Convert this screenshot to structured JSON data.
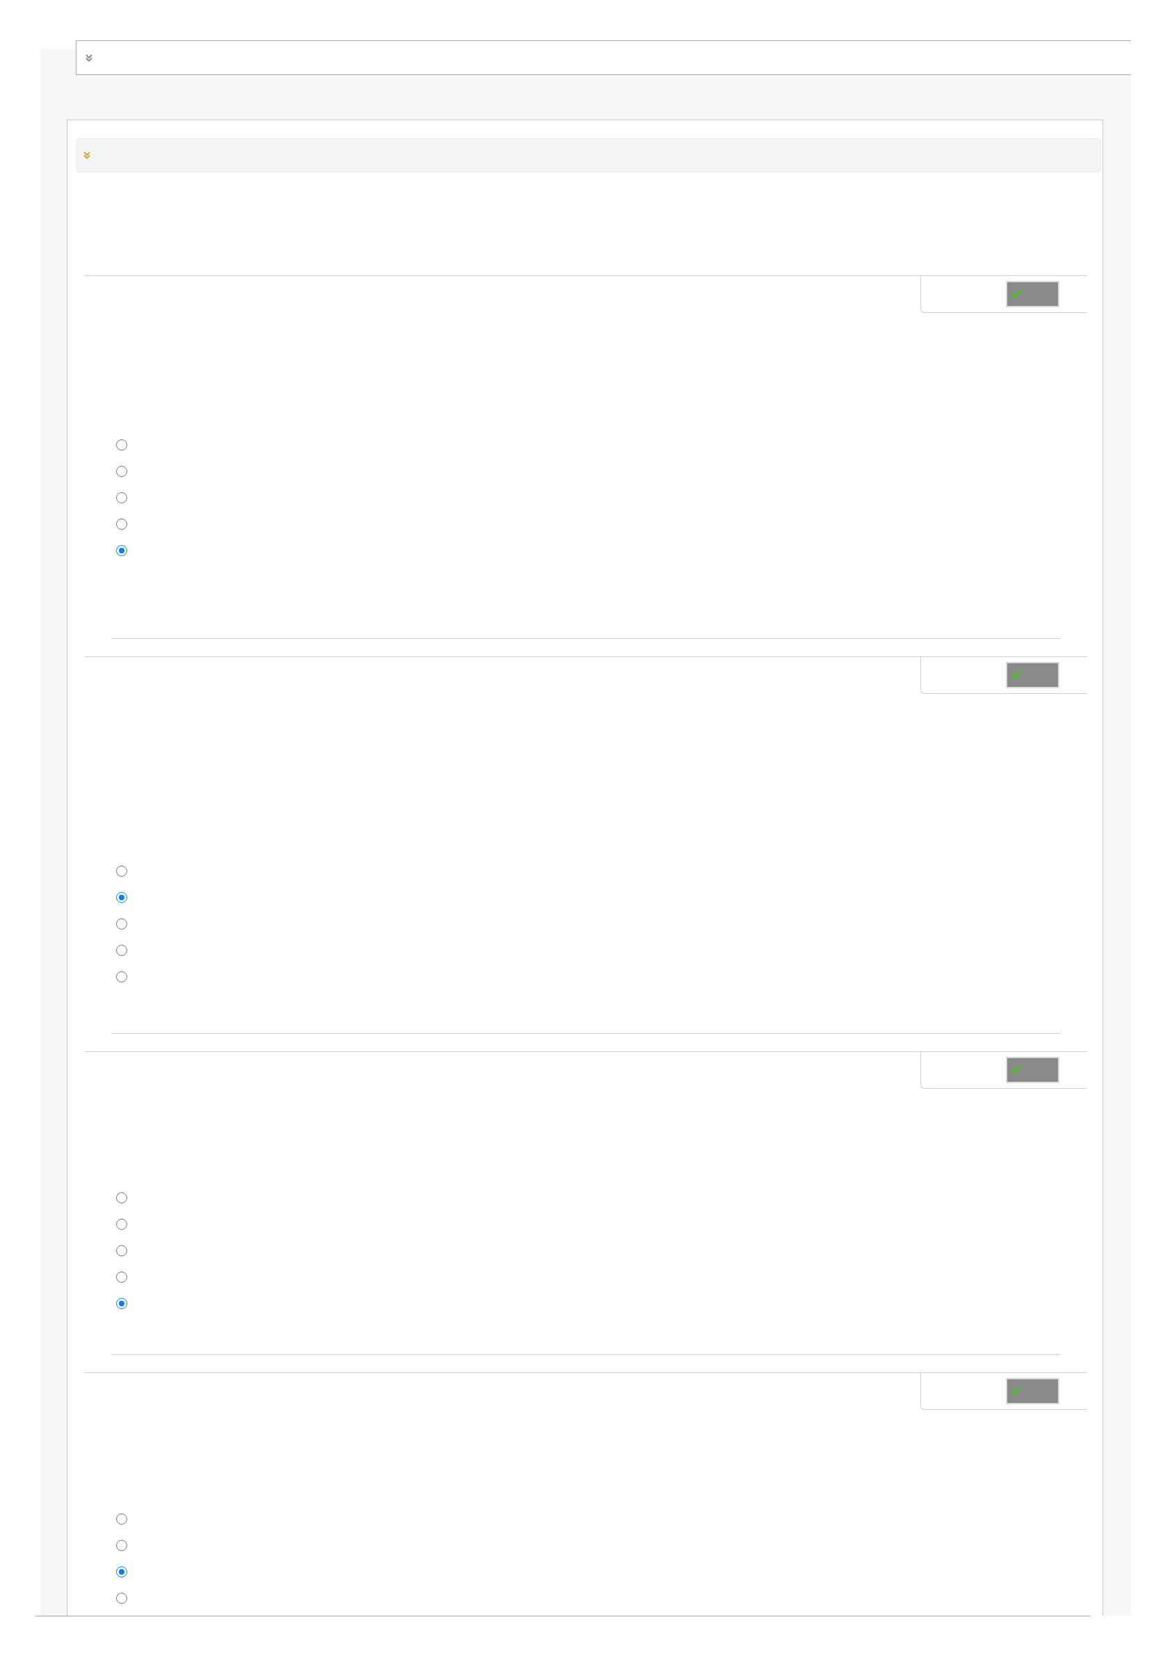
{
  "questions": [
    {
      "correct": true,
      "options": [
        {
          "selected": false
        },
        {
          "selected": false
        },
        {
          "selected": false
        },
        {
          "selected": false
        },
        {
          "selected": true
        }
      ]
    },
    {
      "correct": true,
      "options": [
        {
          "selected": false
        },
        {
          "selected": true
        },
        {
          "selected": false
        },
        {
          "selected": false
        },
        {
          "selected": false
        }
      ]
    },
    {
      "correct": true,
      "options": [
        {
          "selected": false
        },
        {
          "selected": false
        },
        {
          "selected": false
        },
        {
          "selected": false
        },
        {
          "selected": true
        }
      ]
    },
    {
      "correct": true,
      "options": [
        {
          "selected": false
        },
        {
          "selected": false
        },
        {
          "selected": true
        },
        {
          "selected": false
        }
      ]
    }
  ]
}
